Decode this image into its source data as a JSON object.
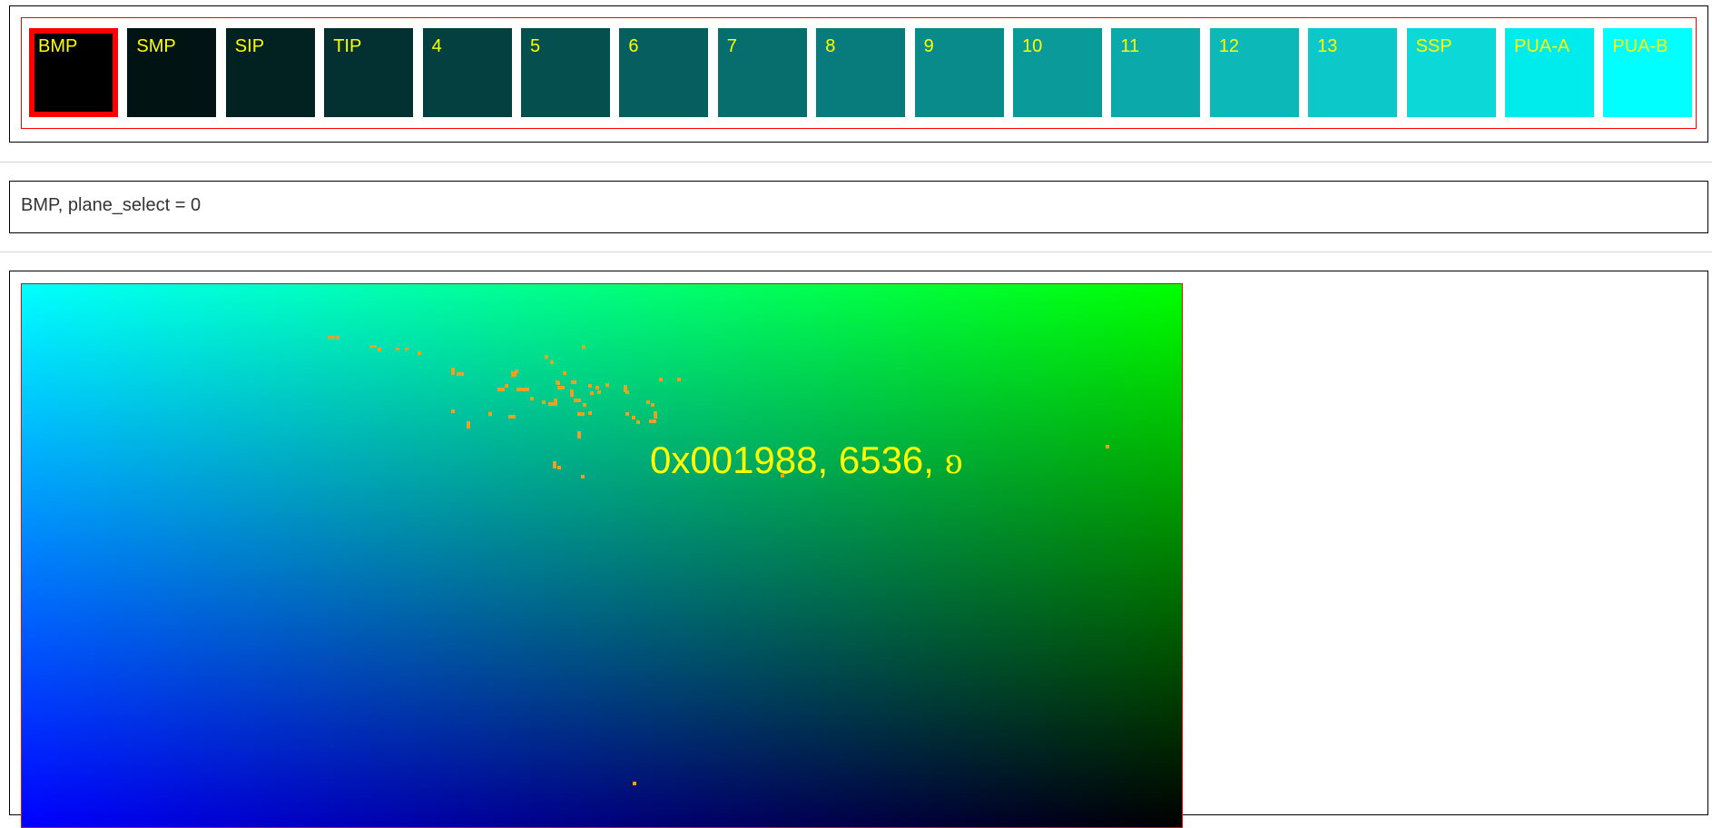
{
  "planes": [
    {
      "label": "BMP",
      "color": "#000000",
      "selected": true
    },
    {
      "label": "SMP",
      "color": "#011313"
    },
    {
      "label": "SIP",
      "color": "#022222"
    },
    {
      "label": "TIP",
      "color": "#033131"
    },
    {
      "label": "4",
      "color": "#044040"
    },
    {
      "label": "5",
      "color": "#054f4f"
    },
    {
      "label": "6",
      "color": "#065e5e"
    },
    {
      "label": "7",
      "color": "#076d6d"
    },
    {
      "label": "8",
      "color": "#087c7c"
    },
    {
      "label": "9",
      "color": "#098b8b"
    },
    {
      "label": "10",
      "color": "#0a9a9a"
    },
    {
      "label": "11",
      "color": "#0ba9a9"
    },
    {
      "label": "12",
      "color": "#0cb8b8"
    },
    {
      "label": "13",
      "color": "#0cc8c8"
    },
    {
      "label": "SSP",
      "color": "#0dd8d8"
    },
    {
      "label": "PUA-A",
      "color": "#00ecec"
    },
    {
      "label": "PUA-B",
      "color": "#00ffff"
    }
  ],
  "plane_label_color": "#ffff00",
  "status": {
    "text": "BMP, plane_select = 0"
  },
  "map": {
    "readout": "0x001988, 6536, ᦈ",
    "readout_color": "#ffff00",
    "gradient": {
      "top_left": "#00ffff",
      "top_right": "#00ff00",
      "bottom_left": "#0000ff",
      "bottom_right": "#000000"
    },
    "highlight_color": "#f0a020"
  }
}
